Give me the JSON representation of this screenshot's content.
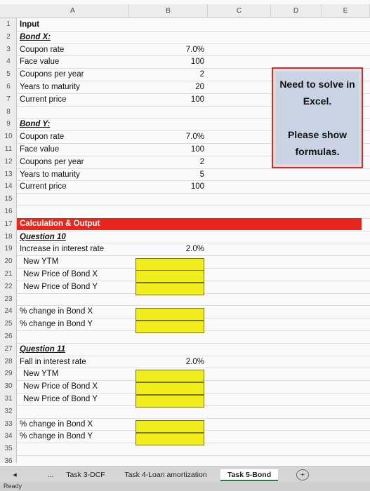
{
  "columns": [
    "A",
    "B",
    "C",
    "D",
    "E"
  ],
  "rows": [
    {
      "n": "1",
      "text": "Input",
      "style": "bold",
      "value": ""
    },
    {
      "n": "2",
      "text": "Bond X:",
      "style": "bold ital ul",
      "value": ""
    },
    {
      "n": "3",
      "text": "Coupon rate",
      "style": "",
      "value": "7.0%"
    },
    {
      "n": "4",
      "text": "Face value",
      "style": "",
      "value": "100"
    },
    {
      "n": "5",
      "text": "Coupons per year",
      "style": "",
      "value": "2"
    },
    {
      "n": "6",
      "text": "Years to maturity",
      "style": "",
      "value": "20"
    },
    {
      "n": "7",
      "text": "Current price",
      "style": "",
      "value": "100"
    },
    {
      "n": "8",
      "text": "",
      "style": "",
      "value": ""
    },
    {
      "n": "9",
      "text": "Bond Y:",
      "style": "bold ital ul",
      "value": ""
    },
    {
      "n": "10",
      "text": "Coupon rate",
      "style": "",
      "value": "7.0%"
    },
    {
      "n": "11",
      "text": "Face value",
      "style": "",
      "value": "100"
    },
    {
      "n": "12",
      "text": "Coupons per year",
      "style": "",
      "value": "2"
    },
    {
      "n": "13",
      "text": "Years to maturity",
      "style": "",
      "value": "5"
    },
    {
      "n": "14",
      "text": "Current price",
      "style": "",
      "value": "100"
    },
    {
      "n": "15",
      "text": "",
      "style": "",
      "value": ""
    },
    {
      "n": "16",
      "text": "",
      "style": "",
      "value": ""
    },
    {
      "n": "17",
      "text": "",
      "style": "",
      "value": ""
    },
    {
      "n": "18",
      "text": "Question 10",
      "style": "bold ital ul",
      "value": ""
    },
    {
      "n": "19",
      "text": "Increase in interest rate",
      "style": "",
      "value": "2.0%"
    },
    {
      "n": "20",
      "text": "New YTM",
      "style": "indent",
      "value": ""
    },
    {
      "n": "21",
      "text": "New Price of Bond X",
      "style": "indent",
      "value": ""
    },
    {
      "n": "22",
      "text": "New Price of Bond Y",
      "style": "indent",
      "value": ""
    },
    {
      "n": "23",
      "text": "",
      "style": "",
      "value": ""
    },
    {
      "n": "24",
      "text": "% change in Bond X",
      "style": "",
      "value": ""
    },
    {
      "n": "25",
      "text": "% change in Bond Y",
      "style": "",
      "value": ""
    },
    {
      "n": "26",
      "text": "",
      "style": "",
      "value": ""
    },
    {
      "n": "27",
      "text": "Question 11",
      "style": "bold ital ul",
      "value": ""
    },
    {
      "n": "28",
      "text": "Fall in interest rate",
      "style": "",
      "value": "2.0%"
    },
    {
      "n": "29",
      "text": "New YTM",
      "style": "indent",
      "value": ""
    },
    {
      "n": "30",
      "text": "New Price of Bond X",
      "style": "indent",
      "value": ""
    },
    {
      "n": "31",
      "text": "New Price of Bond Y",
      "style": "indent",
      "value": ""
    },
    {
      "n": "32",
      "text": "",
      "style": "",
      "value": ""
    },
    {
      "n": "33",
      "text": "% change in Bond X",
      "style": "",
      "value": ""
    },
    {
      "n": "34",
      "text": "% change in Bond Y",
      "style": "",
      "value": ""
    },
    {
      "n": "35",
      "text": "",
      "style": "",
      "value": ""
    },
    {
      "n": "36",
      "text": "",
      "style": "",
      "value": ""
    }
  ],
  "section_header": "Calculation & Output",
  "note": {
    "line1": "Need to solve in",
    "line2": "Excel.",
    "line3": "Please show",
    "line4": "formulas."
  },
  "tabs": {
    "more": "...",
    "t1": "Task 3-DCF",
    "t2": "Task 4-Loan amortization",
    "t3": "Task 5-Bond",
    "add": "+"
  },
  "status": "Ready"
}
